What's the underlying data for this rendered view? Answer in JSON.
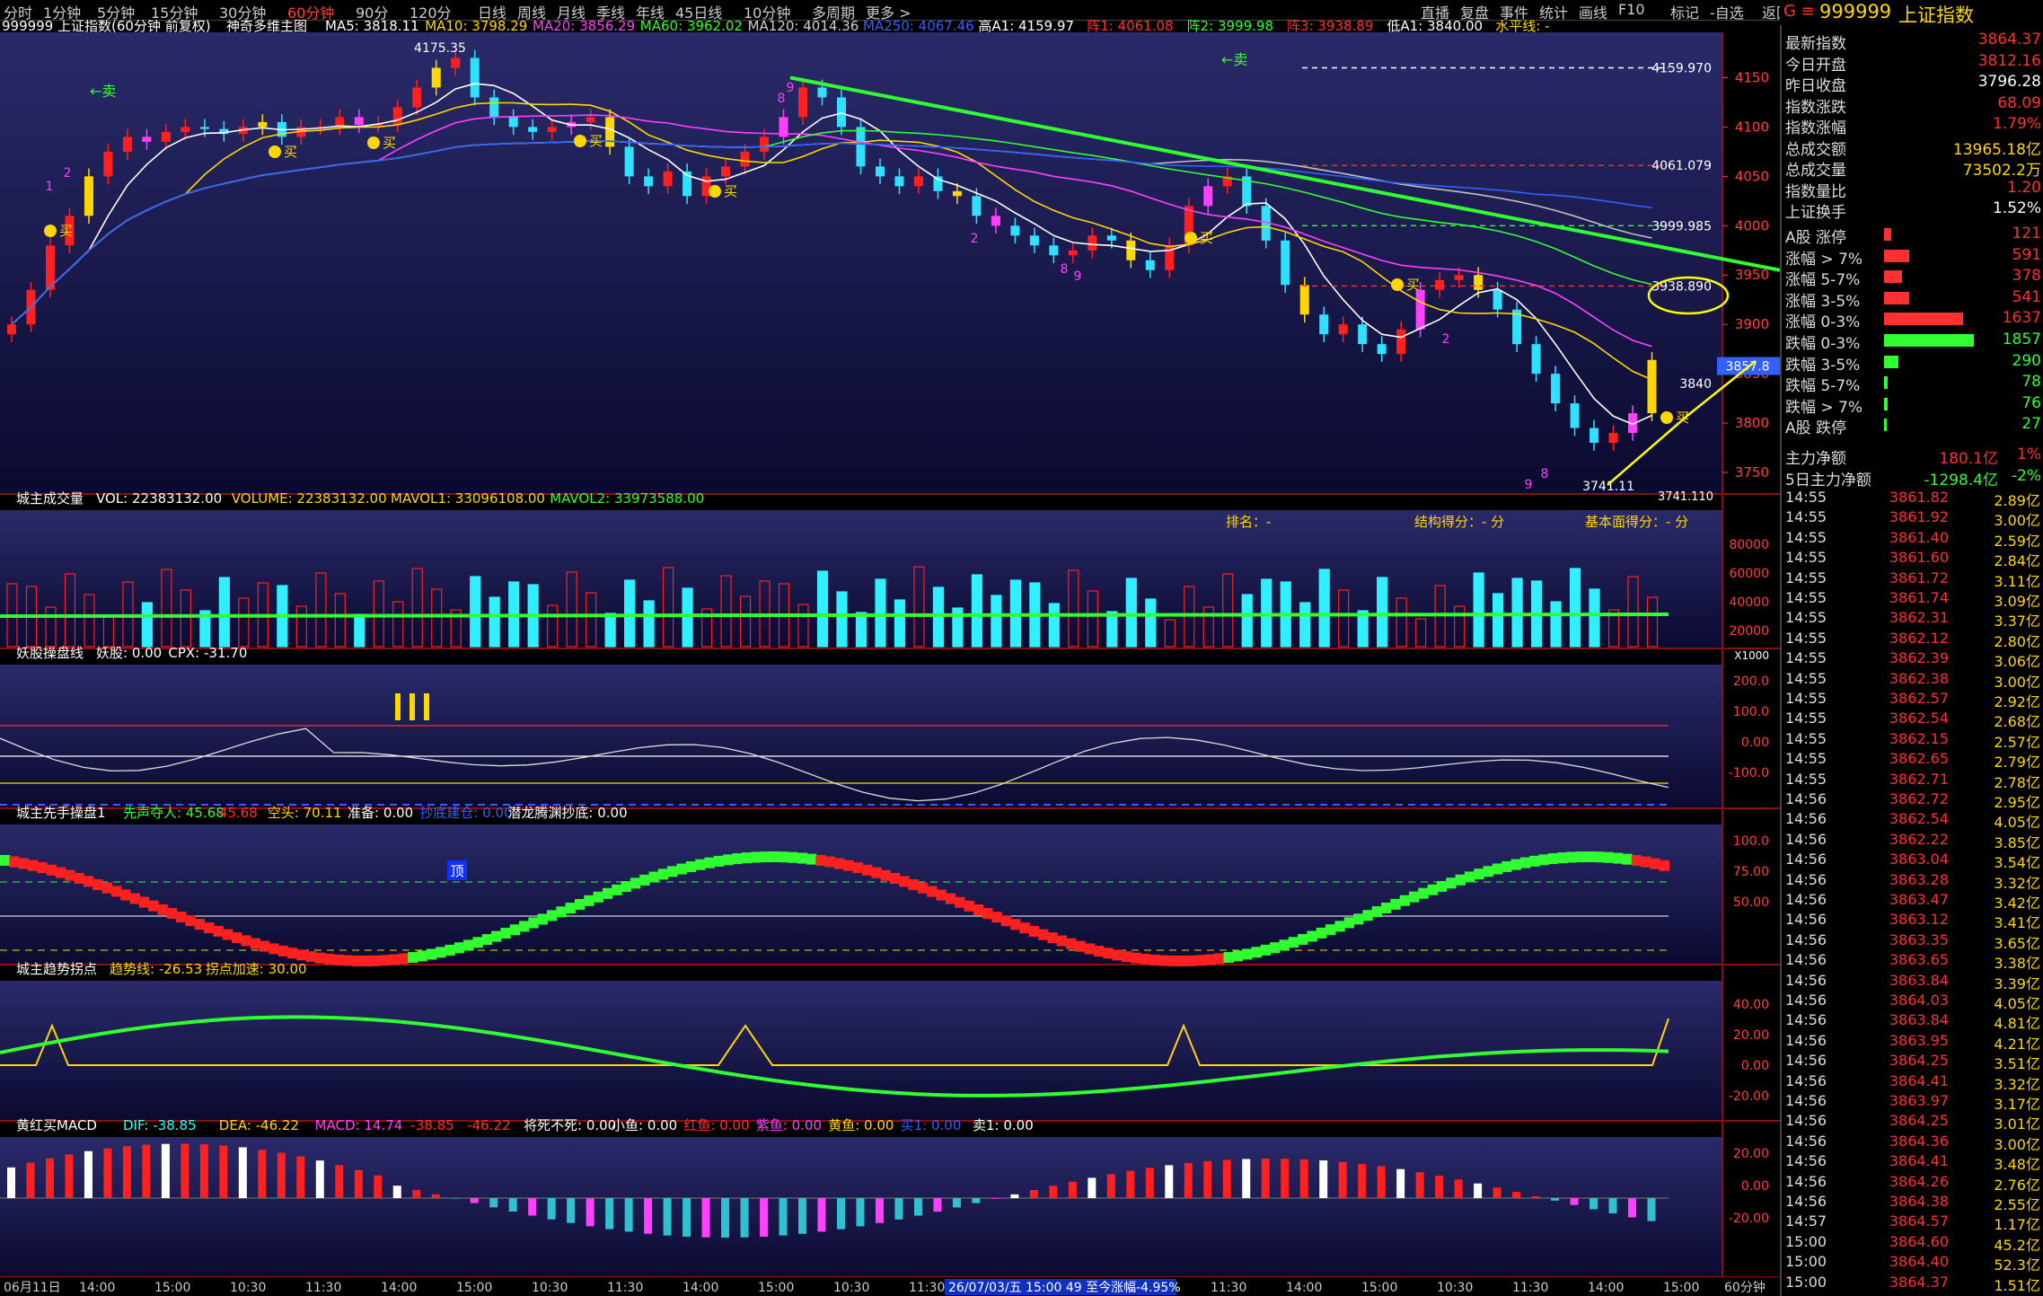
{
  "topbar": {
    "periods": [
      "分时",
      "1分钟",
      "5分钟",
      "15分钟",
      "30分钟",
      "60分钟",
      "90分",
      "120分",
      "日线",
      "周线",
      "月线",
      "季线",
      "年线",
      "45日线",
      "10分钟",
      "多周期",
      "更多 >"
    ],
    "active_period": "60分钟",
    "tools": [
      "直播",
      "复盘",
      "事件",
      "统计",
      "画线",
      "F10",
      "标记",
      "-自选",
      "返回"
    ]
  },
  "quote_header": {
    "prefix": "G ≡",
    "code": "999999",
    "name": "上证指数"
  },
  "main_panel": {
    "title": "999999 上证指数(60分钟 前复权)",
    "indicator": "神奇多维主图",
    "ma": [
      {
        "label": "MA5: 3818.11",
        "color": "#ffffff"
      },
      {
        "label": "MA10: 3798.29",
        "color": "#ffd700"
      },
      {
        "label": "MA20: 3856.29",
        "color": "#ff40ff"
      },
      {
        "label": "MA60: 3962.02",
        "color": "#30ff30"
      },
      {
        "label": "MA120: 4014.36",
        "color": "#d0d0d0"
      },
      {
        "label": "MA250: 4067.46",
        "color": "#3060ff"
      }
    ],
    "extra": [
      {
        "label": "高A1: 4159.97",
        "color": "#ffffff"
      },
      {
        "label": "阵1: 4061.08",
        "color": "#ff3030"
      },
      {
        "label": "阵2: 3999.98",
        "color": "#30ff30"
      },
      {
        "label": "阵3: 3938.89",
        "color": "#ff3030"
      },
      {
        "label": "低A1: 3840.00",
        "color": "#ffffff"
      },
      {
        "label": "水平线: -",
        "color": "#ffd700"
      }
    ],
    "y_ticks": [
      "4150",
      "4100",
      "4050",
      "4000",
      "3950",
      "3900",
      "3850",
      "3800",
      "3750"
    ],
    "level_labels": [
      "4159.970",
      "4061.079",
      "3999.985",
      "3938.890",
      "3840"
    ],
    "price_tag": "3857.8",
    "high_mark": "4175.35",
    "low_mark": "3741.11",
    "low_right": "3741.110",
    "sell_label": "卖",
    "buy_label": "买",
    "count_labels": [
      "1",
      "2",
      "9",
      "2",
      "8",
      "9",
      "2",
      "8",
      "9",
      "8"
    ]
  },
  "volume_panel": {
    "title": "城主成交量",
    "items": [
      {
        "label": "VOL: 22383132.00",
        "color": "#ffffff"
      },
      {
        "label": "VOLUME: 22383132.00",
        "color": "#ffd700"
      },
      {
        "label": "MAVOL1: 33096108.00",
        "color": "#ffd700"
      },
      {
        "label": "MAVOL2: 33973588.00",
        "color": "#30ff30"
      }
    ],
    "rank": "排名：-",
    "structure": "结构得分：- 分",
    "fundamental": "基本面得分：- 分",
    "y_ticks": [
      "80000",
      "60000",
      "40000",
      "20000"
    ],
    "unit": "X1000"
  },
  "yao_panel": {
    "title": "妖股操盘线",
    "items": [
      {
        "label": "妖股: 0.00",
        "color": "#ffffff"
      },
      {
        "label": "CPX: -31.70",
        "color": "#ffffff"
      }
    ],
    "y_ticks": [
      "200.0",
      "100.0",
      "0.00",
      "-100.0"
    ]
  },
  "xianshou_panel": {
    "title": "城主先手操盘1",
    "items": [
      {
        "label": "先声夺人: 45.68",
        "color": "#30ff30"
      },
      {
        "label": "45.68",
        "color": "#ff3030"
      },
      {
        "label": "空头: 70.11",
        "color": "#ffd700"
      },
      {
        "label": "准备: 0.00",
        "color": "#ffffff"
      },
      {
        "label": "抄底建仓: 0.00",
        "color": "#3060ff"
      },
      {
        "label": "潜龙腾渊抄底: 0.00",
        "color": "#ffffff"
      }
    ],
    "top_label": "顶",
    "y_ticks": [
      "100.0",
      "75.00",
      "50.00"
    ]
  },
  "trend_panel": {
    "title": "城主趋势拐点",
    "items": [
      {
        "label": "趋势线: -26.53",
        "color": "#ffd700"
      },
      {
        "label": "拐点加速: 30.00",
        "color": "#ffd700"
      }
    ],
    "y_ticks": [
      "40.00",
      "20.00",
      "0.00",
      "-20.00"
    ]
  },
  "macd_panel": {
    "title": "黄红买MACD",
    "items": [
      {
        "label": "DIF: -38.85",
        "color": "#30ffff"
      },
      {
        "label": "DEA: -46.22",
        "color": "#ffd700"
      },
      {
        "label": "MACD: 14.74",
        "color": "#ff40ff"
      },
      {
        "label": "-38.85",
        "color": "#ff3030"
      },
      {
        "label": "-46.22",
        "color": "#ff3030"
      },
      {
        "label": "将死不死: 0.00",
        "color": "#ffffff"
      },
      {
        "label": "小鱼: 0.00",
        "color": "#ffffff"
      },
      {
        "label": "红鱼: 0.00",
        "color": "#ff3030"
      },
      {
        "label": "紫鱼: 0.00",
        "color": "#ff40ff"
      },
      {
        "label": "黄鱼: 0.00",
        "color": "#ffd700"
      },
      {
        "label": "买1: 0.00",
        "color": "#3060ff"
      },
      {
        "label": "卖1: 0.00",
        "color": "#ffffff"
      }
    ],
    "y_ticks": [
      "20.00",
      "0.00",
      "-20.00"
    ]
  },
  "time_axis": {
    "labels": [
      "06月11日",
      "14:00",
      "15:00",
      "10:30",
      "11:30",
      "14:00",
      "15:00",
      "10:30",
      "11:30",
      "14:00",
      "15:00",
      "10:30",
      "11:30",
      "14:00",
      "15:00",
      "10:30",
      "11:30",
      "14:00",
      "15:00",
      "10:30",
      "11:30",
      "14:00",
      "15:00"
    ],
    "cursor_info": "26/07/03/五 15:00 49 至今涨幅-4.95%",
    "period": "60分钟"
  },
  "quote": {
    "stats": [
      {
        "label": "最新指数",
        "value": "3864.37",
        "color": "#ff3030"
      },
      {
        "label": "今日开盘",
        "value": "3812.16",
        "color": "#ff3030"
      },
      {
        "label": "昨日收盘",
        "value": "3796.28",
        "color": "#ffffff"
      },
      {
        "label": "指数涨跌",
        "value": "68.09",
        "color": "#ff3030"
      },
      {
        "label": "指数涨幅",
        "value": "1.79%",
        "color": "#ff3030"
      },
      {
        "label": "总成交额",
        "value": "13965.18亿",
        "color": "#ffd700"
      },
      {
        "label": "总成交量",
        "value": "73502.2万",
        "color": "#ffd700"
      },
      {
        "label": "指数量比",
        "value": "1.20",
        "color": "#ff3030"
      },
      {
        "label": "上证换手",
        "value": "1.52%",
        "color": "#ffffff"
      }
    ],
    "breadth": [
      {
        "label": "A股 涨停",
        "value": "121",
        "color": "#ff3030",
        "fill": 0.02
      },
      {
        "label": "涨幅 > 7%",
        "value": "591",
        "color": "#ff3030",
        "fill": 0.07
      },
      {
        "label": "涨幅 5-7%",
        "value": "378",
        "color": "#ff3030",
        "fill": 0.05
      },
      {
        "label": "涨幅 3-5%",
        "value": "541",
        "color": "#ff3030",
        "fill": 0.07
      },
      {
        "label": "涨幅 0-3%",
        "value": "1637",
        "color": "#ff3030",
        "fill": 0.22
      },
      {
        "label": "跌幅 0-3%",
        "value": "1857",
        "color": "#30ff30",
        "fill": 0.25
      },
      {
        "label": "跌幅 3-5%",
        "value": "290",
        "color": "#30ff30",
        "fill": 0.04
      },
      {
        "label": "跌幅 5-7%",
        "value": "78",
        "color": "#30ff30",
        "fill": 0.01
      },
      {
        "label": "跌幅 > 7%",
        "value": "76",
        "color": "#30ff30",
        "fill": 0.01
      },
      {
        "label": "A股 跌停",
        "value": "27",
        "color": "#30ff30",
        "fill": 0.005
      }
    ],
    "flows": [
      {
        "label": "主力净额",
        "value": "180.1亿",
        "pct": "1%",
        "color": "#ff3030"
      },
      {
        "label": "5日主力净额",
        "value": "-1298.4亿",
        "pct": "-2%",
        "color": "#30ff30"
      }
    ],
    "ticks": [
      {
        "time": "14:55",
        "price": "3861.82",
        "amount": "2.89亿"
      },
      {
        "time": "14:55",
        "price": "3861.92",
        "amount": "3.00亿"
      },
      {
        "time": "14:55",
        "price": "3861.40",
        "amount": "2.59亿"
      },
      {
        "time": "14:55",
        "price": "3861.60",
        "amount": "2.84亿"
      },
      {
        "time": "14:55",
        "price": "3861.72",
        "amount": "3.11亿"
      },
      {
        "time": "14:55",
        "price": "3861.74",
        "amount": "3.09亿"
      },
      {
        "time": "14:55",
        "price": "3862.31",
        "amount": "3.37亿"
      },
      {
        "time": "14:55",
        "price": "3862.12",
        "amount": "2.80亿"
      },
      {
        "time": "14:55",
        "price": "3862.39",
        "amount": "3.06亿"
      },
      {
        "time": "14:55",
        "price": "3862.38",
        "amount": "3.00亿"
      },
      {
        "time": "14:55",
        "price": "3862.57",
        "amount": "2.92亿"
      },
      {
        "time": "14:55",
        "price": "3862.54",
        "amount": "2.68亿"
      },
      {
        "time": "14:55",
        "price": "3862.15",
        "amount": "2.57亿"
      },
      {
        "time": "14:55",
        "price": "3862.65",
        "amount": "2.79亿"
      },
      {
        "time": "14:55",
        "price": "3862.71",
        "amount": "2.78亿"
      },
      {
        "time": "14:56",
        "price": "3862.72",
        "amount": "2.95亿"
      },
      {
        "time": "14:56",
        "price": "3862.54",
        "amount": "4.05亿"
      },
      {
        "time": "14:56",
        "price": "3862.22",
        "amount": "3.85亿"
      },
      {
        "time": "14:56",
        "price": "3863.04",
        "amount": "3.54亿"
      },
      {
        "time": "14:56",
        "price": "3863.28",
        "amount": "3.32亿"
      },
      {
        "time": "14:56",
        "price": "3863.47",
        "amount": "3.42亿"
      },
      {
        "time": "14:56",
        "price": "3863.12",
        "amount": "3.41亿"
      },
      {
        "time": "14:56",
        "price": "3863.35",
        "amount": "3.65亿"
      },
      {
        "time": "14:56",
        "price": "3863.65",
        "amount": "3.38亿"
      },
      {
        "time": "14:56",
        "price": "3863.84",
        "amount": "3.39亿"
      },
      {
        "time": "14:56",
        "price": "3864.03",
        "amount": "4.05亿"
      },
      {
        "time": "14:56",
        "price": "3863.84",
        "amount": "4.81亿"
      },
      {
        "time": "14:56",
        "price": "3863.95",
        "amount": "4.21亿"
      },
      {
        "time": "14:56",
        "price": "3864.25",
        "amount": "3.51亿"
      },
      {
        "time": "14:56",
        "price": "3864.41",
        "amount": "3.32亿"
      },
      {
        "time": "14:56",
        "price": "3863.97",
        "amount": "3.17亿"
      },
      {
        "time": "14:56",
        "price": "3864.25",
        "amount": "3.01亿"
      },
      {
        "time": "14:56",
        "price": "3864.36",
        "amount": "3.00亿"
      },
      {
        "time": "14:56",
        "price": "3864.41",
        "amount": "3.48亿"
      },
      {
        "time": "14:56",
        "price": "3864.26",
        "amount": "2.76亿"
      },
      {
        "time": "14:56",
        "price": "3864.38",
        "amount": "2.55亿"
      },
      {
        "time": "14:57",
        "price": "3864.57",
        "amount": "1.17亿"
      },
      {
        "time": "15:00",
        "price": "3864.60",
        "amount": "45.2亿"
      },
      {
        "time": "15:00",
        "price": "3864.40",
        "amount": "52.3亿"
      },
      {
        "time": "15:00",
        "price": "3864.37",
        "amount": "1.51亿"
      }
    ]
  }
}
